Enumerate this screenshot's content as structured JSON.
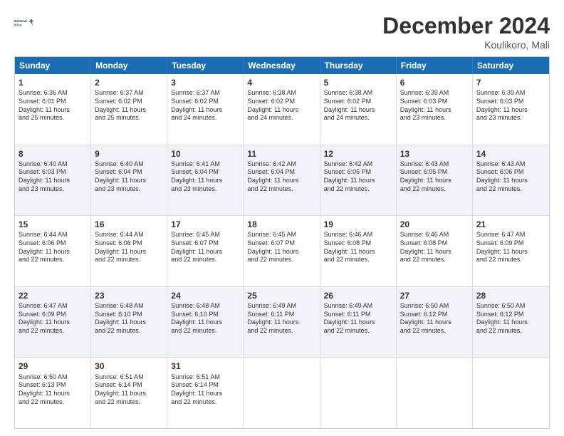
{
  "header": {
    "logo_line1": "General",
    "logo_line2": "Blue",
    "title": "December 2024",
    "subtitle": "Koulikoro, Mali"
  },
  "days": [
    "Sunday",
    "Monday",
    "Tuesday",
    "Wednesday",
    "Thursday",
    "Friday",
    "Saturday"
  ],
  "weeks": [
    [
      {
        "num": "1",
        "lines": [
          "Sunrise: 6:36 AM",
          "Sunset: 6:01 PM",
          "Daylight: 11 hours",
          "and 25 minutes."
        ]
      },
      {
        "num": "2",
        "lines": [
          "Sunrise: 6:37 AM",
          "Sunset: 6:02 PM",
          "Daylight: 11 hours",
          "and 25 minutes."
        ]
      },
      {
        "num": "3",
        "lines": [
          "Sunrise: 6:37 AM",
          "Sunset: 6:02 PM",
          "Daylight: 11 hours",
          "and 24 minutes."
        ]
      },
      {
        "num": "4",
        "lines": [
          "Sunrise: 6:38 AM",
          "Sunset: 6:02 PM",
          "Daylight: 11 hours",
          "and 24 minutes."
        ]
      },
      {
        "num": "5",
        "lines": [
          "Sunrise: 6:38 AM",
          "Sunset: 6:02 PM",
          "Daylight: 11 hours",
          "and 24 minutes."
        ]
      },
      {
        "num": "6",
        "lines": [
          "Sunrise: 6:39 AM",
          "Sunset: 6:03 PM",
          "Daylight: 11 hours",
          "and 23 minutes."
        ]
      },
      {
        "num": "7",
        "lines": [
          "Sunrise: 6:39 AM",
          "Sunset: 6:03 PM",
          "Daylight: 11 hours",
          "and 23 minutes."
        ]
      }
    ],
    [
      {
        "num": "8",
        "lines": [
          "Sunrise: 6:40 AM",
          "Sunset: 6:03 PM",
          "Daylight: 11 hours",
          "and 23 minutes."
        ]
      },
      {
        "num": "9",
        "lines": [
          "Sunrise: 6:40 AM",
          "Sunset: 6:04 PM",
          "Daylight: 11 hours",
          "and 23 minutes."
        ]
      },
      {
        "num": "10",
        "lines": [
          "Sunrise: 6:41 AM",
          "Sunset: 6:04 PM",
          "Daylight: 11 hours",
          "and 23 minutes."
        ]
      },
      {
        "num": "11",
        "lines": [
          "Sunrise: 6:42 AM",
          "Sunset: 6:04 PM",
          "Daylight: 11 hours",
          "and 22 minutes."
        ]
      },
      {
        "num": "12",
        "lines": [
          "Sunrise: 6:42 AM",
          "Sunset: 6:05 PM",
          "Daylight: 11 hours",
          "and 22 minutes."
        ]
      },
      {
        "num": "13",
        "lines": [
          "Sunrise: 6:43 AM",
          "Sunset: 6:05 PM",
          "Daylight: 11 hours",
          "and 22 minutes."
        ]
      },
      {
        "num": "14",
        "lines": [
          "Sunrise: 6:43 AM",
          "Sunset: 6:06 PM",
          "Daylight: 11 hours",
          "and 22 minutes."
        ]
      }
    ],
    [
      {
        "num": "15",
        "lines": [
          "Sunrise: 6:44 AM",
          "Sunset: 6:06 PM",
          "Daylight: 11 hours",
          "and 22 minutes."
        ]
      },
      {
        "num": "16",
        "lines": [
          "Sunrise: 6:44 AM",
          "Sunset: 6:06 PM",
          "Daylight: 11 hours",
          "and 22 minutes."
        ]
      },
      {
        "num": "17",
        "lines": [
          "Sunrise: 6:45 AM",
          "Sunset: 6:07 PM",
          "Daylight: 11 hours",
          "and 22 minutes."
        ]
      },
      {
        "num": "18",
        "lines": [
          "Sunrise: 6:45 AM",
          "Sunset: 6:07 PM",
          "Daylight: 11 hours",
          "and 22 minutes."
        ]
      },
      {
        "num": "19",
        "lines": [
          "Sunrise: 6:46 AM",
          "Sunset: 6:08 PM",
          "Daylight: 11 hours",
          "and 22 minutes."
        ]
      },
      {
        "num": "20",
        "lines": [
          "Sunrise: 6:46 AM",
          "Sunset: 6:08 PM",
          "Daylight: 11 hours",
          "and 22 minutes."
        ]
      },
      {
        "num": "21",
        "lines": [
          "Sunrise: 6:47 AM",
          "Sunset: 6:09 PM",
          "Daylight: 11 hours",
          "and 22 minutes."
        ]
      }
    ],
    [
      {
        "num": "22",
        "lines": [
          "Sunrise: 6:47 AM",
          "Sunset: 6:09 PM",
          "Daylight: 11 hours",
          "and 22 minutes."
        ]
      },
      {
        "num": "23",
        "lines": [
          "Sunrise: 6:48 AM",
          "Sunset: 6:10 PM",
          "Daylight: 11 hours",
          "and 22 minutes."
        ]
      },
      {
        "num": "24",
        "lines": [
          "Sunrise: 6:48 AM",
          "Sunset: 6:10 PM",
          "Daylight: 11 hours",
          "and 22 minutes."
        ]
      },
      {
        "num": "25",
        "lines": [
          "Sunrise: 6:49 AM",
          "Sunset: 6:11 PM",
          "Daylight: 11 hours",
          "and 22 minutes."
        ]
      },
      {
        "num": "26",
        "lines": [
          "Sunrise: 6:49 AM",
          "Sunset: 6:11 PM",
          "Daylight: 11 hours",
          "and 22 minutes."
        ]
      },
      {
        "num": "27",
        "lines": [
          "Sunrise: 6:50 AM",
          "Sunset: 6:12 PM",
          "Daylight: 11 hours",
          "and 22 minutes."
        ]
      },
      {
        "num": "28",
        "lines": [
          "Sunrise: 6:50 AM",
          "Sunset: 6:12 PM",
          "Daylight: 11 hours",
          "and 22 minutes."
        ]
      }
    ],
    [
      {
        "num": "29",
        "lines": [
          "Sunrise: 6:50 AM",
          "Sunset: 6:13 PM",
          "Daylight: 11 hours",
          "and 22 minutes."
        ]
      },
      {
        "num": "30",
        "lines": [
          "Sunrise: 6:51 AM",
          "Sunset: 6:14 PM",
          "Daylight: 11 hours",
          "and 22 minutes."
        ]
      },
      {
        "num": "31",
        "lines": [
          "Sunrise: 6:51 AM",
          "Sunset: 6:14 PM",
          "Daylight: 11 hours",
          "and 22 minutes."
        ]
      },
      {
        "num": "",
        "lines": []
      },
      {
        "num": "",
        "lines": []
      },
      {
        "num": "",
        "lines": []
      },
      {
        "num": "",
        "lines": []
      }
    ]
  ]
}
